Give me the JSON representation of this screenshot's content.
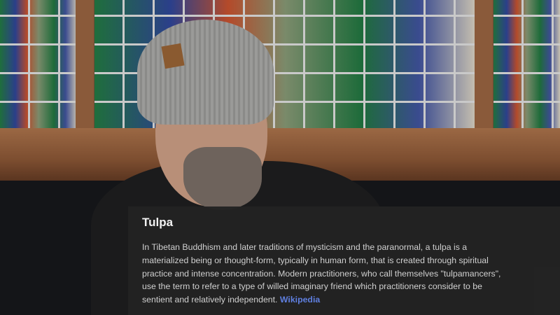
{
  "card": {
    "title": "Tulpa",
    "lines": [
      "In Tibetan Buddhism and later traditions of mysticism and the paranormal, a tulpa is a",
      "materialized being or thought-form, typically in human form, that is created through spiritual",
      "practice and intense concentration. Modern practitioners, who call themselves \"tulpamancers\",",
      "use the term to refer to a type of willed imaginary friend which practitioners consider to be",
      "sentient and relatively independent."
    ],
    "source_link": "Wikipedia"
  }
}
